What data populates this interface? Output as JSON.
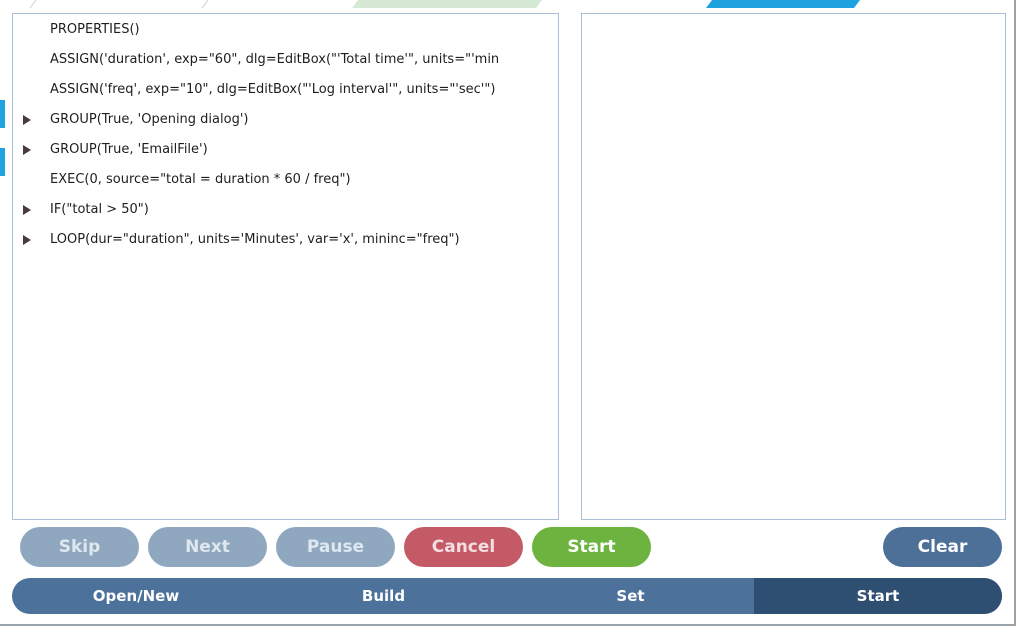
{
  "script_lines": [
    {
      "text": "PROPERTIES()",
      "expandable": false
    },
    {
      "text": "ASSIGN('duration', exp=\"60\", dlg=EditBox(\"'Total time'\", units=\"'min",
      "expandable": false
    },
    {
      "text": "ASSIGN('freq', exp=\"10\", dlg=EditBox(\"'Log interval'\", units=\"'sec'\")",
      "expandable": false
    },
    {
      "text": "GROUP(True, 'Opening dialog')",
      "expandable": true
    },
    {
      "text": "GROUP(True, 'EmailFile')",
      "expandable": true
    },
    {
      "text": "EXEC(0, source=\"total = duration * 60 / freq\")",
      "expandable": false
    },
    {
      "text": "IF(\"total > 50\")",
      "expandable": true
    },
    {
      "text": "LOOP(dur=\"duration\", units='Minutes', var='x', mininc=\"freq\")",
      "expandable": true
    }
  ],
  "buttons": {
    "skip": "Skip",
    "next": "Next",
    "pause": "Pause",
    "cancel": "Cancel",
    "start": "Start",
    "clear": "Clear"
  },
  "nav": {
    "open_new": "Open/New",
    "build": "Build",
    "set": "Set",
    "start": "Start",
    "active": "Start"
  },
  "colors": {
    "accent": "#1fa3e0",
    "nav_bg": "#4c729b",
    "nav_active": "#2f4f72",
    "start_green": "#6db33f",
    "cancel_red": "#c45a66",
    "disabled": "#8fa8bf"
  }
}
